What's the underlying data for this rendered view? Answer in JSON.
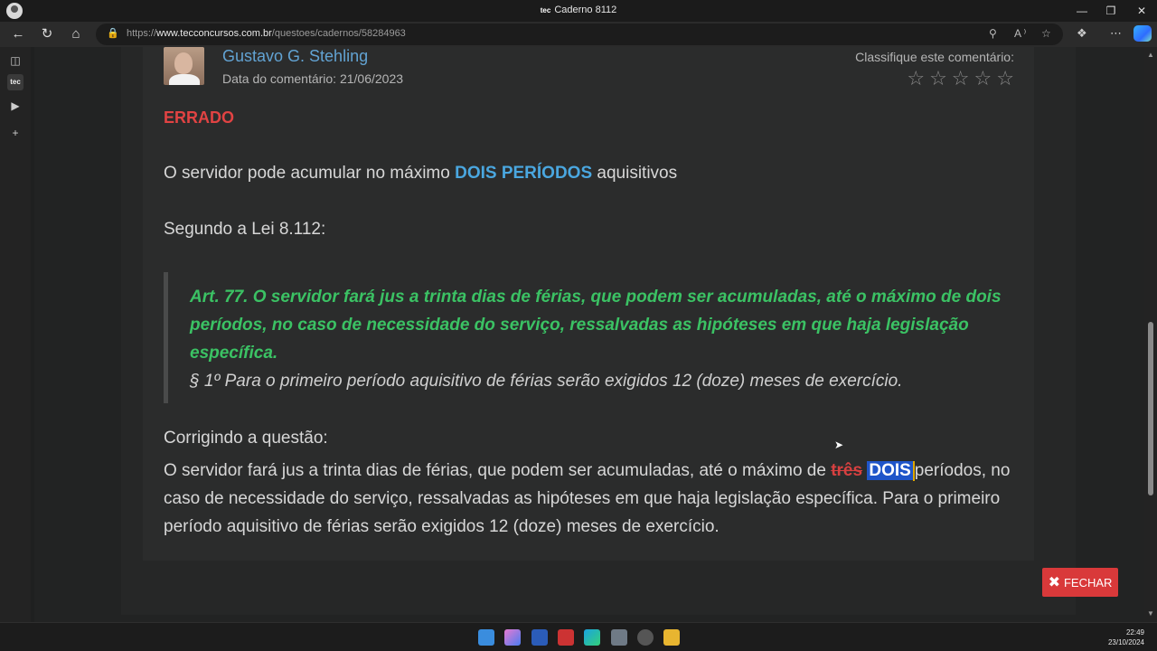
{
  "window": {
    "title": "Caderno 8112",
    "tab_badge": "tec"
  },
  "browser": {
    "url_prefix": "https://",
    "url_domain": "www.tecconcursos.com.br",
    "url_path": "/questoes/cadernos/58284963"
  },
  "comment": {
    "author": "Gustavo G. Stehling",
    "date_label": "Data do comentário: 21/06/2023",
    "classify_label": "Classifique este comentário:",
    "rating": 0,
    "verdict": "ERRADO",
    "p1_before": "O servidor pode acumular no máximo ",
    "p1_highlight": "DOIS PERÍODOS",
    "p1_after": " aquisitivos",
    "p2": "Segundo a Lei 8.112:",
    "law_text": "Art. 77.  O servidor fará jus a trinta dias de férias, que podem ser acumuladas, até o máximo de dois períodos, no caso de necessidade do serviço, ressalvadas as hipóteses em que haja legislação específica.",
    "law_paragraph": "§ 1º Para o primeiro período aquisitivo de férias serão exigidos 12 (doze) meses de exercício.",
    "correction_label": "Corrigindo a questão:",
    "correction_before": "O servidor fará jus a trinta dias de férias, que podem ser acumuladas, até o máximo de ",
    "correction_struck": "três",
    "correction_new": "DOIS",
    "correction_after": "períodos, no caso de necessidade do serviço, ressalvadas as hipóteses em que haja legislação específica. Para o primeiro período aquisitivo de férias serão exigidos 12 (doze) meses de exercício."
  },
  "close_button": "FECHAR",
  "taskbar": {
    "time": "22:49",
    "date": "23/10/2024"
  }
}
